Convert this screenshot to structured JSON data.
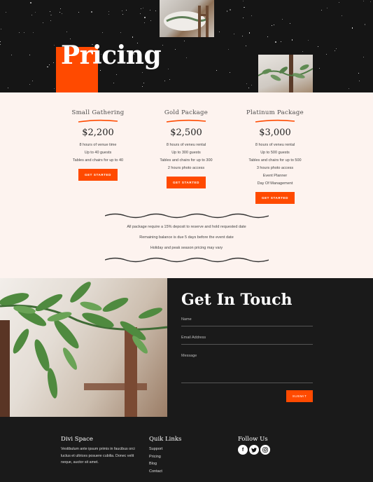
{
  "hero": {
    "title": "Pricing"
  },
  "pricing": {
    "packages": [
      {
        "name": "Small Gathering",
        "price": "$2,200",
        "features": [
          "8 hours of venue time",
          "Up to 40 guests",
          "Tables and chairs for up to 40"
        ],
        "button": "GET STARTED"
      },
      {
        "name": "Gold Package",
        "price": "$2,500",
        "features": [
          "8 hours of veneu rental",
          "Up to 300 guests",
          "Tables and chairs for up to 300",
          "2 hours photo access"
        ],
        "button": "GET STARTED"
      },
      {
        "name": "Platinum Package",
        "price": "$3,000",
        "features": [
          "8 hours of veneu rental",
          "Up to 500 guests",
          "Tables and chairs for up to 500",
          "3 hours photo access",
          "Event Planner",
          "Day Of Management"
        ],
        "button": "GET STARTED"
      }
    ],
    "notes": [
      "All package require a 15% deposit to reserve and hold requested date",
      "Remaining balance is due 5 days before the event date",
      "Holiday and peak season pricing may vary"
    ]
  },
  "contact": {
    "title": "Get In Touch",
    "name_label": "Name",
    "email_label": "Email Address",
    "message_label": "Message",
    "submit": "SUBMIT"
  },
  "footer": {
    "about_title": "Divi Space",
    "about_text": "Vestibulum ante ipsum primis in faucibus orci luctus et ultrices posuere cubilia. Donec velit neque, auctor sit amet.",
    "links_title": "Quik Links",
    "links": [
      "Support",
      "Pricing",
      "Blog",
      "Contact"
    ],
    "follow_title": "Follow Us",
    "social": [
      "facebook-icon",
      "twitter-icon",
      "instagram-icon"
    ]
  },
  "colors": {
    "accent": "#ff4a00",
    "cream": "#fdf3ef",
    "dark": "#1a1a1a"
  }
}
